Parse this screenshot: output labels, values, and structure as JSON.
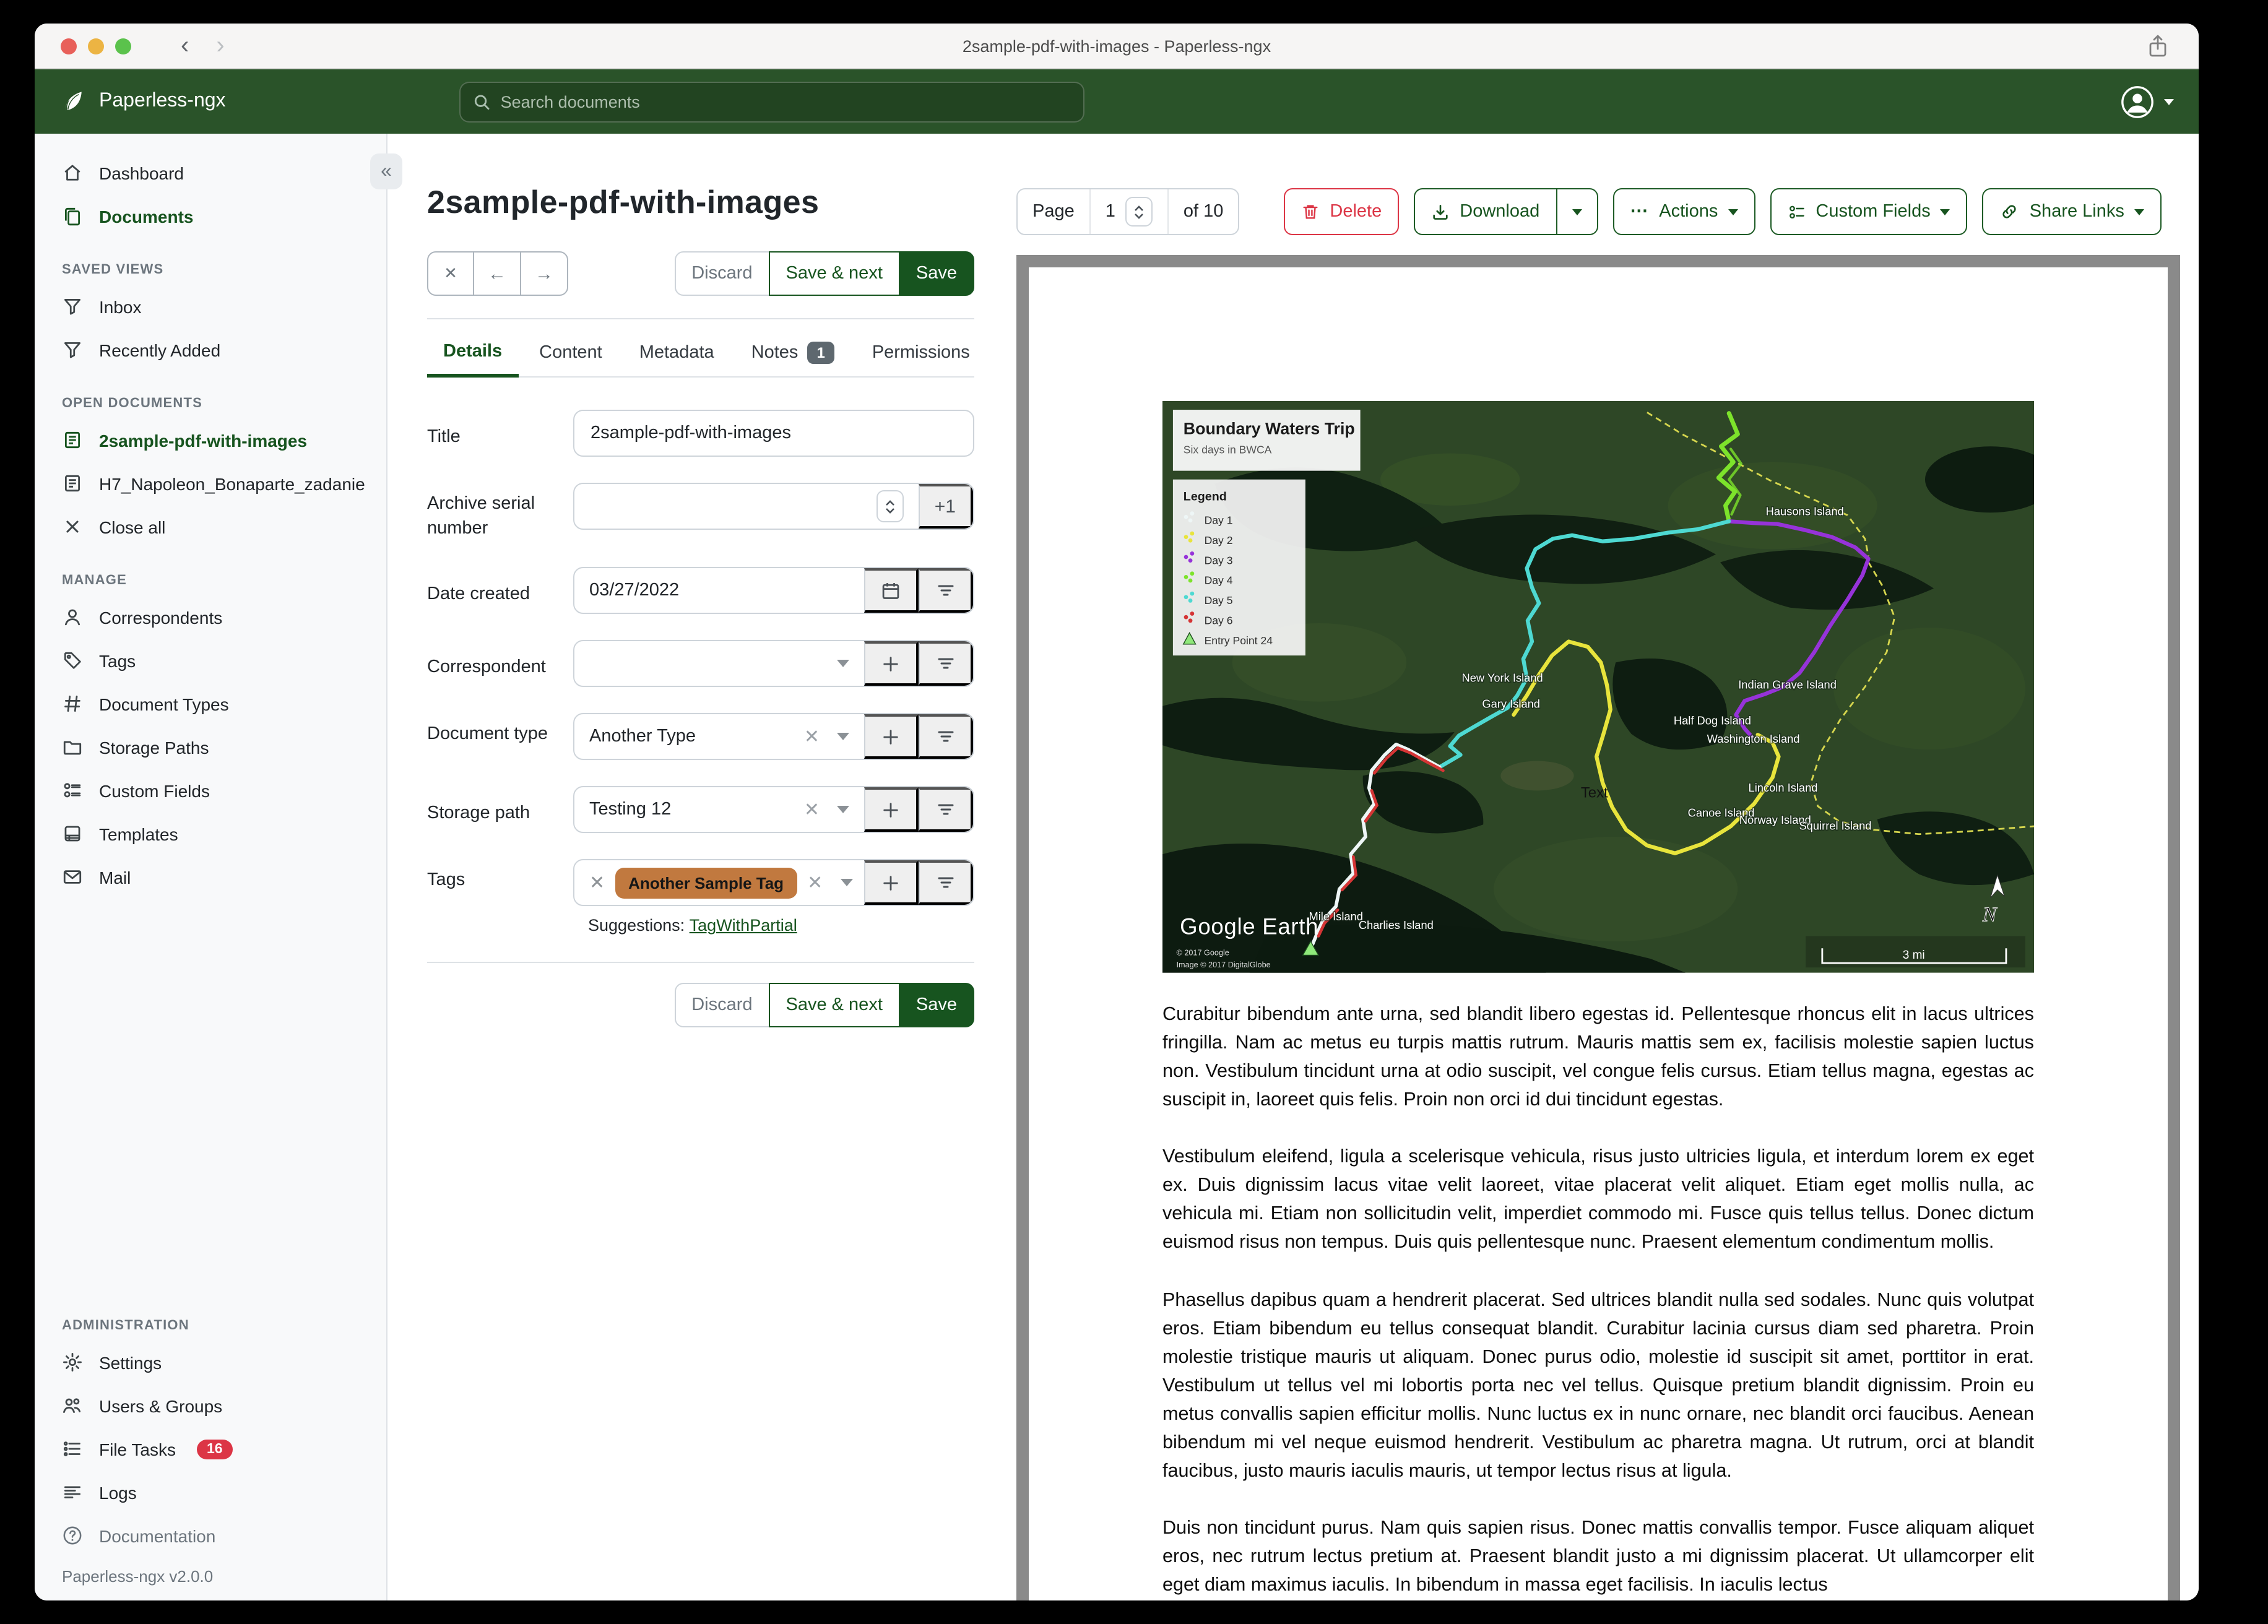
{
  "window": {
    "title": "2sample-pdf-with-images - Paperless-ngx"
  },
  "icons": {
    "close": "✕",
    "back": "←",
    "forward": "→",
    "collapse": "«",
    "chevron_back": "‹",
    "chevron_forward": "›",
    "dots": "⋯",
    "plus": "+"
  },
  "navbar": {
    "brand": "Paperless-ngx",
    "search_placeholder": "Search documents"
  },
  "sidebar": {
    "main": [
      {
        "label": "Dashboard"
      },
      {
        "label": "Documents"
      }
    ],
    "saved_views": {
      "heading": "SAVED VIEWS",
      "items": [
        {
          "label": "Inbox"
        },
        {
          "label": "Recently Added"
        }
      ]
    },
    "open_documents": {
      "heading": "OPEN DOCUMENTS",
      "items": [
        {
          "label": "2sample-pdf-with-images"
        },
        {
          "label": "H7_Napoleon_Bonaparte_zadanie"
        },
        {
          "label": "Close all"
        }
      ]
    },
    "manage": {
      "heading": "MANAGE",
      "items": [
        {
          "label": "Correspondents"
        },
        {
          "label": "Tags"
        },
        {
          "label": "Document Types"
        },
        {
          "label": "Storage Paths"
        },
        {
          "label": "Custom Fields"
        },
        {
          "label": "Templates"
        },
        {
          "label": "Mail"
        }
      ]
    },
    "administration": {
      "heading": "ADMINISTRATION",
      "items": [
        {
          "label": "Settings"
        },
        {
          "label": "Users & Groups"
        },
        {
          "label": "File Tasks",
          "badge": "16"
        },
        {
          "label": "Logs"
        }
      ]
    },
    "footer": {
      "documentation": "Documentation",
      "version": "Paperless-ngx v2.0.0"
    }
  },
  "doc": {
    "title": "2sample-pdf-with-images",
    "actions": {
      "discard": "Discard",
      "save_next": "Save & next",
      "save": "Save"
    },
    "tabs": [
      {
        "label": "Details"
      },
      {
        "label": "Content"
      },
      {
        "label": "Metadata"
      },
      {
        "label": "Notes",
        "badge": "1"
      },
      {
        "label": "Permissions"
      }
    ],
    "fields": {
      "title": {
        "label": "Title",
        "value": "2sample-pdf-with-images"
      },
      "asn": {
        "label": "Archive serial number",
        "value": "",
        "plus_one": "+1"
      },
      "date_created": {
        "label": "Date created",
        "value": "03/27/2022"
      },
      "correspondent": {
        "label": "Correspondent",
        "value": ""
      },
      "document_type": {
        "label": "Document type",
        "value": "Another Type"
      },
      "storage_path": {
        "label": "Storage path",
        "value": "Testing 12"
      },
      "tags": {
        "label": "Tags",
        "chips": [
          {
            "label": "Another Sample Tag",
            "color": "#c1793f"
          }
        ],
        "suggestions_label": "Suggestions:",
        "suggestions": [
          {
            "label": "TagWithPartial"
          }
        ]
      }
    }
  },
  "toolbar": {
    "page_label": "Page",
    "page_value": "1",
    "page_of": "of 10",
    "delete": "Delete",
    "download": "Download",
    "actions": "Actions",
    "custom_fields": "Custom Fields",
    "share_links": "Share Links"
  },
  "preview": {
    "map": {
      "title": "Boundary Waters Trip",
      "subtitle": "Six days in BWCA",
      "legend_title": "Legend",
      "legend": [
        {
          "label": "Day 1",
          "color": "#eef6f6"
        },
        {
          "label": "Day 2",
          "color": "#e8e43c"
        },
        {
          "label": "Day 3",
          "color": "#9633d9"
        },
        {
          "label": "Day 4",
          "color": "#7de32b"
        },
        {
          "label": "Day 5",
          "color": "#4ed9d2"
        },
        {
          "label": "Day 6",
          "color": "#d53535"
        },
        {
          "label": "Entry Point 24",
          "color": "#8fe87a"
        }
      ],
      "islands": [
        {
          "name": "Hausons Island"
        },
        {
          "name": "New York Island"
        },
        {
          "name": "Gary Island"
        },
        {
          "name": "Indian Grave Island"
        },
        {
          "name": "Half Dog Island"
        },
        {
          "name": "Washington Island"
        },
        {
          "name": "Lincoln Island"
        },
        {
          "name": "Canoe Island"
        },
        {
          "name": "Norway Island"
        },
        {
          "name": "Squirrel Island"
        },
        {
          "name": "Mile Island"
        },
        {
          "name": "Charlies Island"
        }
      ],
      "text_label": "Text",
      "watermark": "Google Earth",
      "copyright_1": "© 2017 Google",
      "copyright_2": "Image © 2017 DigitalGlobe",
      "scale_label": "3 mi"
    },
    "paragraphs": [
      "Curabitur bibendum ante urna, sed blandit libero egestas id. Pellentesque rhoncus elit in lacus ultrices fringilla. Nam ac metus eu turpis mattis rutrum. Mauris mattis sem ex, facilisis molestie sapien luctus non. Vestibulum tincidunt urna at odio suscipit, vel congue felis cursus. Etiam tellus magna, egestas ac suscipit in, laoreet quis felis. Proin non orci id dui tincidunt egestas.",
      "Vestibulum eleifend, ligula a scelerisque vehicula, risus justo ultricies ligula, et interdum lorem ex eget ex. Duis dignissim lacus vitae velit laoreet, vitae placerat velit aliquet. Etiam eget mollis nulla, ac vehicula mi. Etiam non sollicitudin velit, imperdiet commodo mi. Fusce quis tellus tellus. Donec dictum euismod risus non tempus. Duis quis pellentesque nunc. Praesent elementum condimentum mollis.",
      "Phasellus dapibus quam a hendrerit placerat. Sed ultrices blandit nulla sed sodales. Nunc quis volutpat eros. Etiam bibendum eu tellus consequat blandit. Curabitur lacinia cursus diam sed pharetra. Proin molestie tristique mauris ut aliquam. Donec purus odio, molestie id suscipit sit amet, porttitor in erat. Vestibulum ut tellus vel mi lobortis porta nec vel tellus. Quisque pretium blandit dignissim. Proin eu metus convallis sapien efficitur mollis. Nunc luctus ex in nunc ornare, nec blandit orci faucibus. Aenean bibendum mi vel neque euismod hendrerit. Vestibulum ac pharetra magna. Ut rutrum, orci at blandit faucibus, justo mauris iaculis mauris, ut tempor lectus risus at ligula.",
      "Duis non tincidunt purus. Nam quis sapien risus. Donec mattis convallis tempor. Fusce aliquam aliquet eros, nec rutrum lectus pretium at. Praesent blandit justo a mi dignissim placerat. Ut ullamcorper elit eget diam maximus iaculis. In bibendum in massa eget facilisis. In iaculis lectus"
    ]
  },
  "colors": {
    "navbar_green": "#2a5329",
    "accent_green": "#17541f",
    "danger_red": "#dc3545",
    "tag_orange": "#c1793f",
    "frame_gray": "#8a8a8a"
  }
}
